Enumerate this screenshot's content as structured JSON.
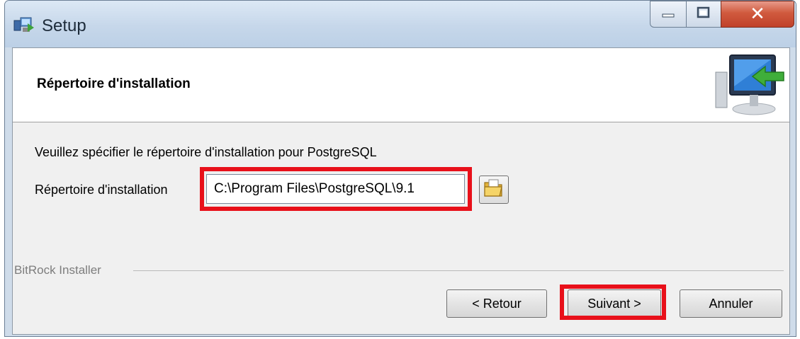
{
  "window": {
    "title": "Setup",
    "icon": "setup-app-icon",
    "controls": [
      "minimize-icon",
      "maximize-icon",
      "close-icon"
    ]
  },
  "header": {
    "title": "Répertoire d'installation",
    "icon": "computer-install-arrow-icon"
  },
  "body": {
    "description": "Veuillez spécifier le répertoire d'installation pour PostgreSQL",
    "field_label": "Répertoire d'installation",
    "install_path": "C:\\Program Files\\PostgreSQL\\9.1",
    "browse_icon": "open-folder-icon"
  },
  "footer": {
    "brand": "BitRock Installer",
    "back_label": "< Retour",
    "next_label": "Suivant >",
    "cancel_label": "Annuler"
  },
  "colors": {
    "highlight": "#e8101a",
    "titlebar": "#c6d7ea",
    "close_button": "#c0412a"
  }
}
